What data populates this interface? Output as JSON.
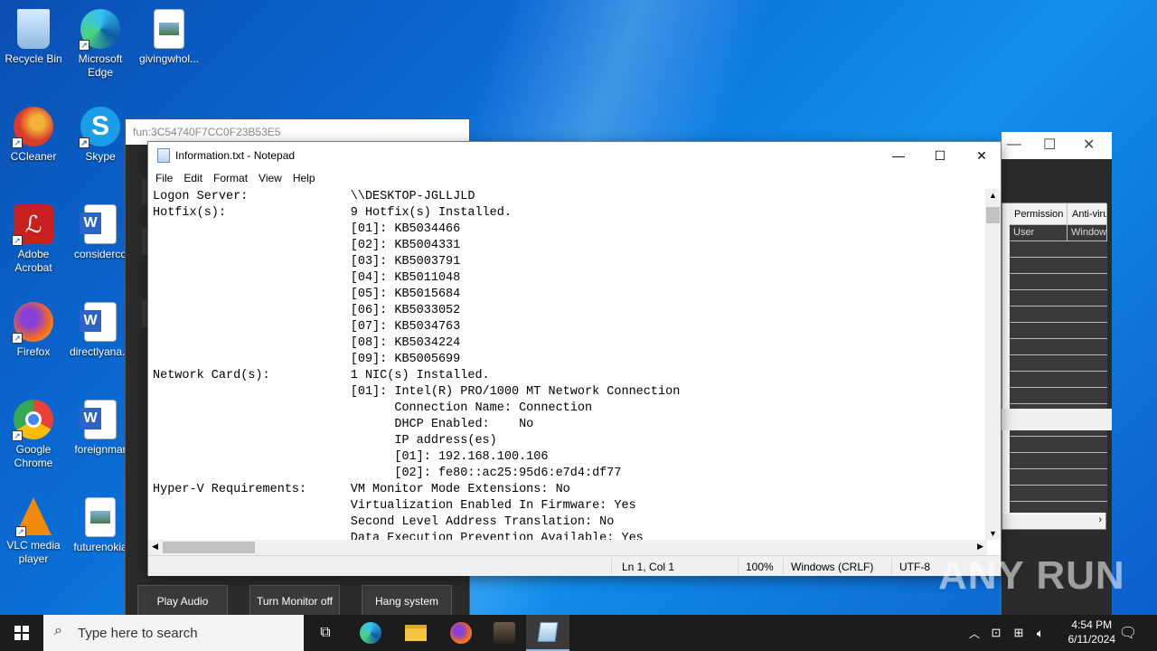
{
  "desktop_icons": [
    {
      "label": "Recycle Bin",
      "color": "#9ec9f0"
    },
    {
      "label": "Microsoft Edge",
      "color": "#1fa0d8"
    },
    {
      "label": "givingwhol...",
      "color": "#ffffff"
    },
    {
      "label": "CCleaner",
      "color": "#d83b2a"
    },
    {
      "label": "Skype",
      "color": "#1a9ee8"
    },
    {
      "label": "Adobe Acrobat",
      "color": "#c8201f"
    },
    {
      "label": "considerco",
      "color": "#2b63c8"
    },
    {
      "label": "Firefox",
      "color": "#f26a22"
    },
    {
      "label": "directlyana...",
      "color": "#2b63c8"
    },
    {
      "label": "Google Chrome",
      "color": "#34a853"
    },
    {
      "label": "foreignmar",
      "color": "#2b63c8"
    },
    {
      "label": "VLC media player",
      "color": "#f08a0c"
    },
    {
      "label": "futurenokia",
      "color": "#ffffff"
    }
  ],
  "bg_window": {
    "title": "fun:3C54740F7CC0F23B53E5",
    "buttons": [
      "Play Audio",
      "Turn Monitor off",
      "Hang system"
    ]
  },
  "right_window": {
    "headers": [
      "Permission",
      "Anti-viru"
    ],
    "row": [
      "User",
      "Window"
    ]
  },
  "notepad": {
    "title": "Information.txt - Notepad",
    "menu": [
      "File",
      "Edit",
      "Format",
      "View",
      "Help"
    ],
    "content": "Logon Server:              \\\\DESKTOP-JGLLJLD\nHotfix(s):                 9 Hotfix(s) Installed.\n                           [01]: KB5034466\n                           [02]: KB5004331\n                           [03]: KB5003791\n                           [04]: KB5011048\n                           [05]: KB5015684\n                           [06]: KB5033052\n                           [07]: KB5034763\n                           [08]: KB5034224\n                           [09]: KB5005699\nNetwork Card(s):           1 NIC(s) Installed.\n                           [01]: Intel(R) PRO/1000 MT Network Connection\n                                 Connection Name: Connection\n                                 DHCP Enabled:    No\n                                 IP address(es)\n                                 [01]: 192.168.100.106\n                                 [02]: fe80::ac25:95d6:e7d4:df77\nHyper-V Requirements:      VM Monitor Mode Extensions: No\n                           Virtualization Enabled In Firmware: Yes\n                           Second Level Address Translation: No\n                           Data Execution Prevention Available: Yes",
    "status": {
      "position": "Ln 1, Col 1",
      "zoom": "100%",
      "line_endings": "Windows (CRLF)",
      "encoding": "UTF-8"
    }
  },
  "watermark": "ANY RUN",
  "taskbar": {
    "search_placeholder": "Type here to search",
    "time": "4:54 PM",
    "date": "6/11/2024"
  }
}
